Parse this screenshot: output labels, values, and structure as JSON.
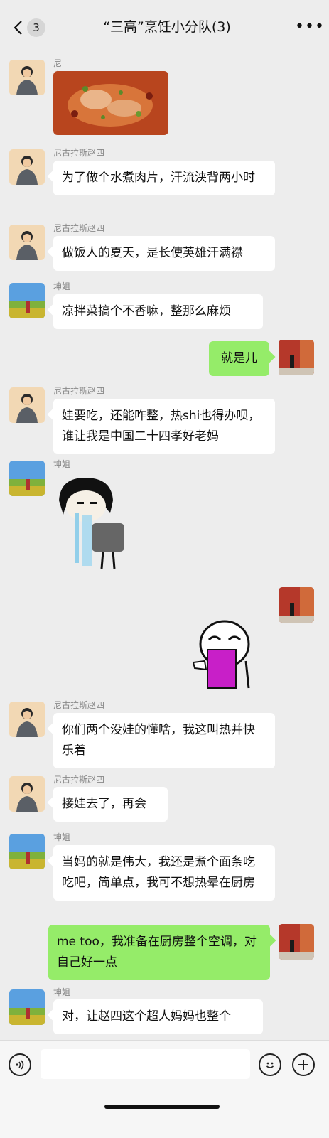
{
  "header": {
    "back_count": "3",
    "title": "“三高”烹饪小分队(3)",
    "more_label": "•••"
  },
  "senders": {
    "zhaosi": "尼古拉斯赵四",
    "kunjie": "坤姐"
  },
  "messages": {
    "m2": "为了做个水煮肉片，汗流浃背两小时",
    "m3": "做饭人的夏天，是长使英雄汗满襟",
    "m4": "凉拌菜搞个不香嘛，整那么麻烦",
    "m5": "就是儿",
    "m6": "娃要吃，还能咋整，热shi也得办呗，谁让我是中国二十四孝好老妈",
    "m9": "你们两个没娃的懂啥，我这叫热并快乐着",
    "m10": "接娃去了，再会",
    "m11": "当妈的就是伟大，我还是煮个面条吃吃吧，简单点，我可不想热晕在厨房",
    "m12": "me too，我准备在厨房整个空调，对自己好一点",
    "m13": "对，让赵四这个超人妈妈也整个"
  },
  "colors": {
    "background": "#ededed",
    "self_bubble": "#95ec69",
    "other_bubble": "#ffffff"
  },
  "icons": [
    "back-arrow-icon",
    "more-icon",
    "voice-icon",
    "emoji-icon",
    "plus-icon"
  ]
}
